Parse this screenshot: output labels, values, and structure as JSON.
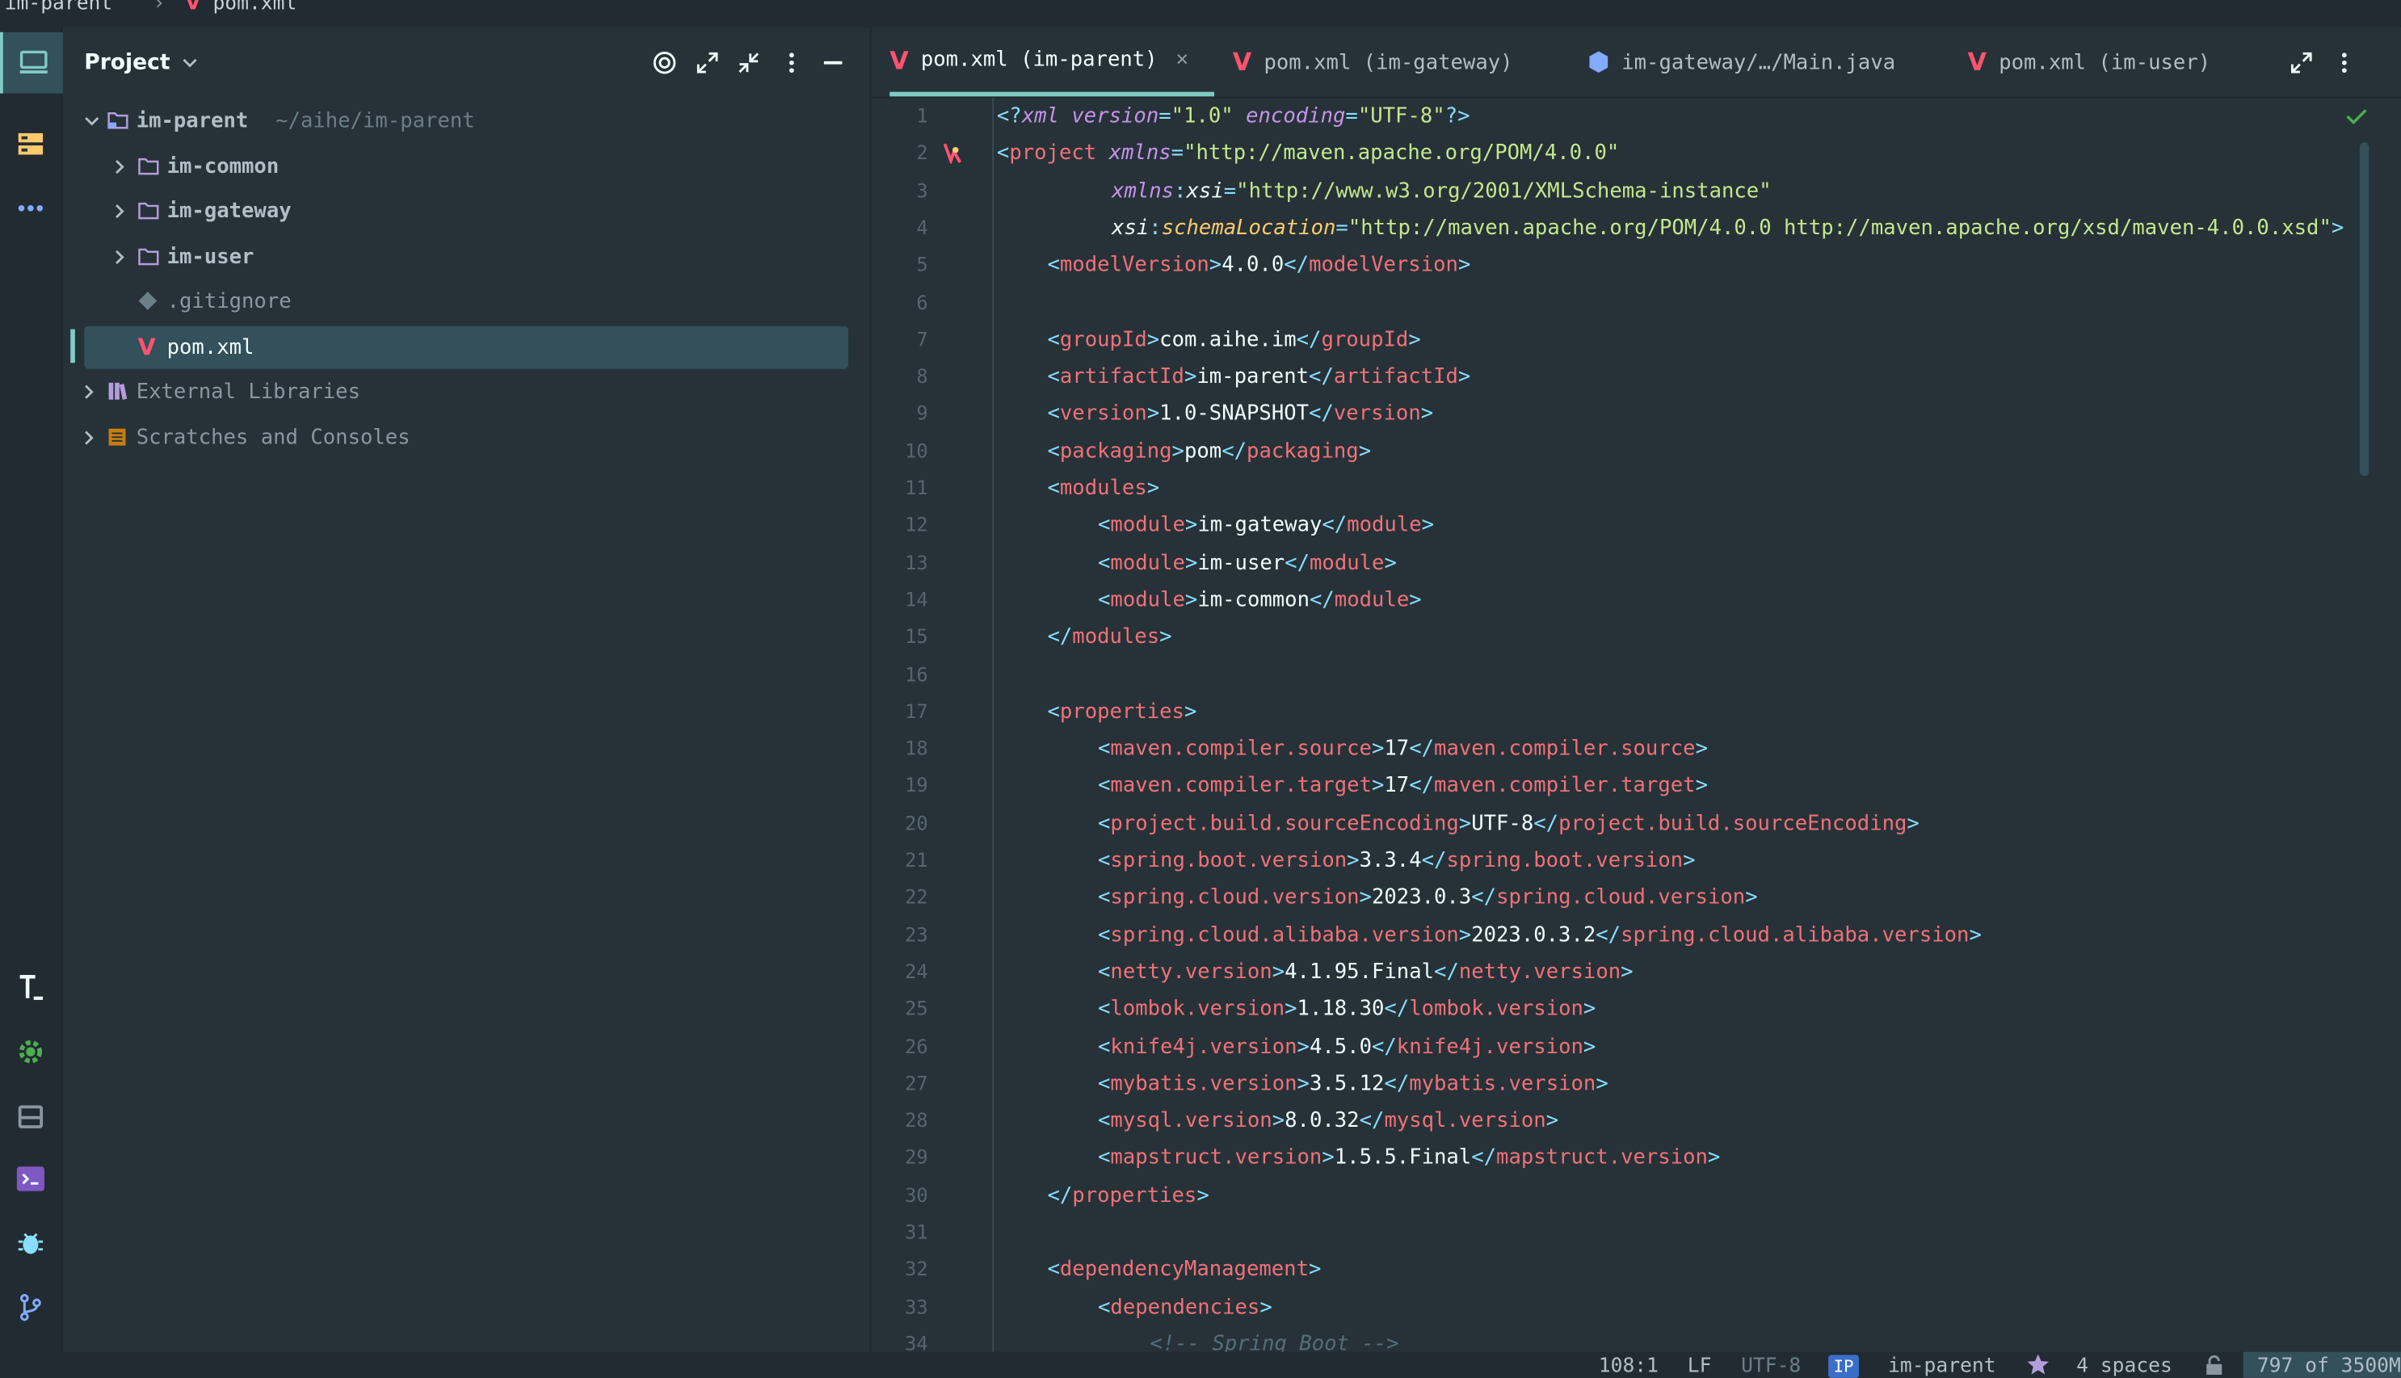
{
  "breadcrumb": {
    "project": "im-parent",
    "file": "pom.xml",
    "maven_mark": "V"
  },
  "panel": {
    "title": "Project",
    "tree": [
      {
        "label": "im-parent",
        "hint": "~/aihe/im-parent"
      },
      {
        "label": "im-common"
      },
      {
        "label": "im-gateway"
      },
      {
        "label": "im-user"
      },
      {
        "label": ".gitignore"
      },
      {
        "label": "pom.xml"
      },
      {
        "label": "External Libraries"
      },
      {
        "label": "Scratches and Consoles"
      }
    ]
  },
  "tabs": [
    {
      "label": "pom.xml (im-parent)",
      "close": "×"
    },
    {
      "label": "pom.xml (im-gateway)"
    },
    {
      "label": "im-gateway/…/Main.java"
    },
    {
      "label": "pom.xml (im-user)"
    }
  ],
  "editor": {
    "line_numbers": [
      "1",
      "2",
      "3",
      "4",
      "5",
      "6",
      "7",
      "8",
      "9",
      "10",
      "11",
      "12",
      "13",
      "14",
      "15",
      "16",
      "17",
      "18",
      "19",
      "20",
      "21",
      "22",
      "23",
      "24",
      "25",
      "26",
      "27",
      "28",
      "29",
      "30",
      "31",
      "32",
      "33",
      "34"
    ],
    "lines": {
      "l1": {
        "decl": "xml",
        "a1": "version",
        "v1": "\"1.0\"",
        "a2": "encoding",
        "v2": "\"UTF-8\""
      },
      "l2": {
        "tag": "project",
        "attr": "xmlns",
        "val": "\"http://maven.apache.org/POM/4.0.0\""
      },
      "l3": {
        "prefix": "xmlns",
        "attr": "xsi",
        "val": "\"http://www.w3.org/2001/XMLSchema-instance\""
      },
      "l4": {
        "prefix": "xsi",
        "attr": "schemaLocation",
        "val": "\"http://maven.apache.org/POM/4.0.0 http://maven.apache.org/xsd/maven-4.0.0.xsd\""
      },
      "l5": {
        "tag": "modelVersion",
        "text": "4.0.0"
      },
      "l7": {
        "tag": "groupId",
        "text": "com.aihe.im"
      },
      "l8": {
        "tag": "artifactId",
        "text": "im-parent"
      },
      "l9": {
        "tag": "version",
        "text": "1.0-SNAPSHOT"
      },
      "l10": {
        "tag": "packaging",
        "text": "pom"
      },
      "l11": {
        "tag": "modules"
      },
      "l12": {
        "tag": "module",
        "text": "im-gateway"
      },
      "l13": {
        "tag": "module",
        "text": "im-user"
      },
      "l14": {
        "tag": "module",
        "text": "im-common"
      },
      "l15": {
        "tag": "modules"
      },
      "l17": {
        "tag": "properties"
      },
      "l18": {
        "tag": "maven.compiler.source",
        "text": "17"
      },
      "l19": {
        "tag": "maven.compiler.target",
        "text": "17"
      },
      "l20": {
        "tag": "project.build.sourceEncoding",
        "text": "UTF-8"
      },
      "l21": {
        "tag": "spring.boot.version",
        "text": "3.3.4"
      },
      "l22": {
        "tag": "spring.cloud.version",
        "text": "2023.0.3"
      },
      "l23": {
        "tag": "spring.cloud.alibaba.version",
        "text": "2023.0.3.2"
      },
      "l24": {
        "tag": "netty.version",
        "text": "4.1.95.Final"
      },
      "l25": {
        "tag": "lombok.version",
        "text": "1.18.30"
      },
      "l26": {
        "tag": "knife4j.version",
        "text": "4.5.0"
      },
      "l27": {
        "tag": "mybatis.version",
        "text": "3.5.12"
      },
      "l28": {
        "tag": "mysql.version",
        "text": "8.0.32"
      },
      "l29": {
        "tag": "mapstruct.version",
        "text": "1.5.5.Final"
      },
      "l30": {
        "tag": "properties"
      },
      "l32": {
        "tag": "dependencyManagement"
      },
      "l33": {
        "tag": "dependencies"
      },
      "l34": {
        "text": "<!-- Spring Boot -->"
      }
    }
  },
  "status": {
    "position": "108:1",
    "line_sep": "LF",
    "encoding": "UTF-8",
    "project_badge": "IP",
    "project": "im-parent",
    "indent": "4 spaces",
    "memory": "797 of 3500M"
  },
  "colors": {
    "background": "#263238",
    "accent": "#80cbc4",
    "tag": "#f07178",
    "string": "#c3e88d",
    "attr": "#c792ea",
    "punct": "#89ddff",
    "maven": "#ff5370"
  }
}
